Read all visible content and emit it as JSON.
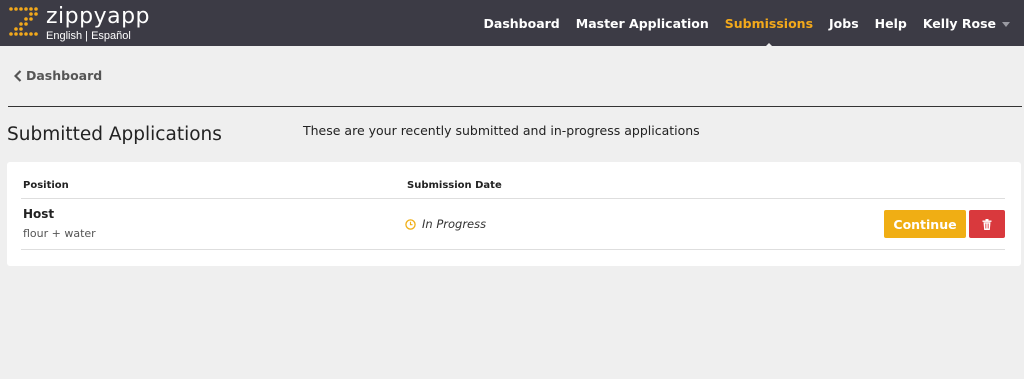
{
  "brand": {
    "name_part1": "zippy",
    "name_part2": "app",
    "lang_en": "English",
    "lang_sep": " | ",
    "lang_es": "Español",
    "accent": "#f3a91b",
    "header_bg": "#3c3b45"
  },
  "nav": {
    "items": [
      {
        "label": "Dashboard",
        "active": false
      },
      {
        "label": "Master Application",
        "active": false
      },
      {
        "label": "Submissions",
        "active": true
      },
      {
        "label": "Jobs",
        "active": false
      },
      {
        "label": "Help",
        "active": false
      },
      {
        "label": "Kelly Rose",
        "active": false
      }
    ]
  },
  "breadcrumb": {
    "back_label": "Dashboard",
    "back_icon": "chevron-left-icon"
  },
  "page": {
    "title": "Submitted Applications",
    "subtitle": "These are your recently submitted and in-progress applications"
  },
  "table": {
    "headers": {
      "position": "Position",
      "submission_date": "Submission Date"
    },
    "rows": [
      {
        "position": "Host",
        "company": "flour + water",
        "status": "In Progress",
        "status_icon": "clock-icon",
        "continue_label": "Continue",
        "delete_icon": "trash-icon"
      }
    ]
  },
  "colors": {
    "continue": "#f0ae14",
    "delete": "#d9393d",
    "status_icon": "#f0ae14"
  }
}
